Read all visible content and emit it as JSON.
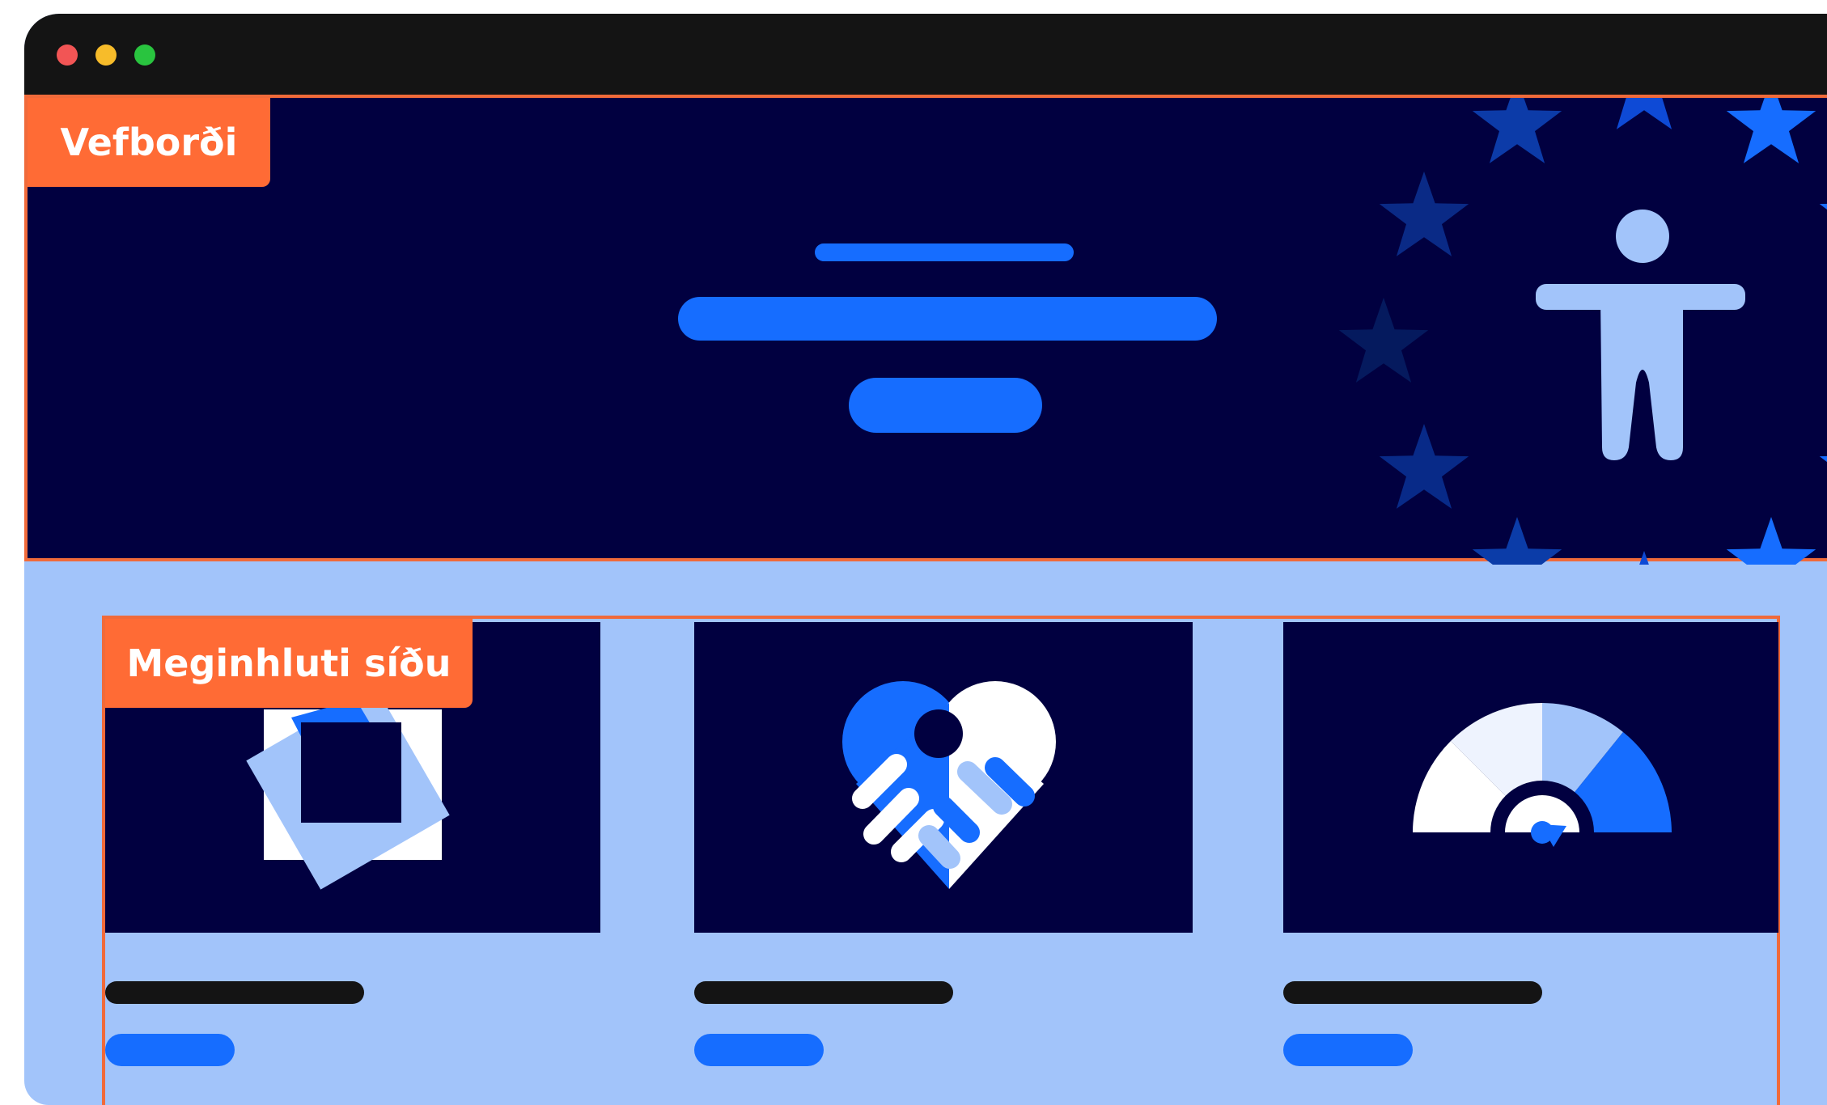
{
  "window": {
    "controls": [
      "close",
      "minimize",
      "maximize"
    ]
  },
  "hero": {
    "region_label": "Vefborði",
    "figure_icon": "accessibility-person-icon",
    "decor_icon": "eu-stars-ring"
  },
  "main": {
    "region_label": "Meginhluti síðu",
    "cards": [
      {
        "icon": "rotating-squares-icon"
      },
      {
        "icon": "handshake-heart-icon"
      },
      {
        "icon": "gauge-meter-icon"
      }
    ]
  },
  "colors": {
    "accent": "#FF6B35",
    "navy": "#010040",
    "blue": "#166DFF",
    "light_blue": "#A2C4FA",
    "pale": "#EEF3FE",
    "dark_bar": "#141414"
  }
}
